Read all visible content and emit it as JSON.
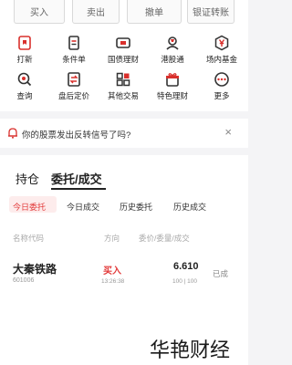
{
  "top_buttons": [
    "买入",
    "卖出",
    "撤单",
    "银证转账"
  ],
  "shortcuts": [
    {
      "label": "打新",
      "icon": "bookmark-icon"
    },
    {
      "label": "条件单",
      "icon": "document-icon"
    },
    {
      "label": "国债理财",
      "icon": "bond-icon"
    },
    {
      "label": "港股通",
      "icon": "person-flag-icon"
    },
    {
      "label": "场内基金",
      "icon": "yen-badge-icon"
    },
    {
      "label": "查询",
      "icon": "search-icon"
    },
    {
      "label": "盘后定价",
      "icon": "swap-icon"
    },
    {
      "label": "其他交易",
      "icon": "grid-icon"
    },
    {
      "label": "特色理财",
      "icon": "gift-icon"
    },
    {
      "label": "更多",
      "icon": "more-icon"
    }
  ],
  "notice": {
    "text": "你的股票发出反转信号了吗?",
    "close": "×"
  },
  "main_tabs": [
    "持仓",
    "委托/成交"
  ],
  "sub_tabs": [
    "今日委托",
    "今日成交",
    "历史委托",
    "历史成交"
  ],
  "columns": [
    "名称代码",
    "方向",
    "委价/委量/成交"
  ],
  "order": {
    "name": "大秦铁路",
    "code": "601006",
    "direction": "买入",
    "time": "13:26:38",
    "price": "6.610",
    "quantity": "100 | 100",
    "status": "已成"
  },
  "watermark": "华艳财经",
  "colors": {
    "accent": "#e23a3a",
    "icon_red": "#d9302c"
  }
}
